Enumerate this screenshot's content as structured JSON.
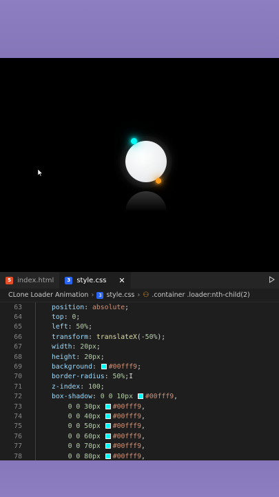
{
  "colors": {
    "accent_cyan": "#00fff9",
    "accent_orange": "#ff9a1a",
    "editor_bg": "#1e1e1e",
    "frame": "#8a7cbc"
  },
  "tabs": [
    {
      "label": "index.html",
      "icon": "html5-icon",
      "active": false
    },
    {
      "label": "style.css",
      "icon": "css3-icon",
      "active": true,
      "close": "✕"
    }
  ],
  "breadcrumb": {
    "project": "CLone Loader Animation",
    "file": "style.css",
    "selector": ".container .loader:nth-child(2)"
  },
  "code_lines": [
    {
      "n": "63",
      "prop": "position",
      "value": "absolute"
    },
    {
      "n": "64",
      "prop": "top",
      "value": "0"
    },
    {
      "n": "65",
      "prop": "left",
      "value": "50%"
    },
    {
      "n": "66",
      "prop": "transform",
      "fn": "translateX",
      "arg": "-50%"
    },
    {
      "n": "67",
      "prop": "width",
      "value": "20px"
    },
    {
      "n": "68",
      "prop": "height",
      "value": "20px"
    },
    {
      "n": "69",
      "prop": "background",
      "color": "#00fff9"
    },
    {
      "n": "70",
      "prop": "border-radius",
      "value": "50%"
    },
    {
      "n": "71",
      "prop": "z-index",
      "value": "100"
    },
    {
      "n": "72",
      "prop": "box-shadow",
      "offset": "0 0 10px",
      "color": "#00fff9"
    },
    {
      "n": "73",
      "offset": "0 0 30px",
      "color": "#00fff9"
    },
    {
      "n": "74",
      "offset": "0 0 40px",
      "color": "#00fff9"
    },
    {
      "n": "75",
      "offset": "0 0 50px",
      "color": "#00fff9"
    },
    {
      "n": "76",
      "offset": "0 0 60px",
      "color": "#00fff9"
    },
    {
      "n": "77",
      "offset": "0 0 70px",
      "color": "#00fff9"
    },
    {
      "n": "78",
      "offset": "0 0 80px",
      "color": "#00fff9"
    }
  ]
}
